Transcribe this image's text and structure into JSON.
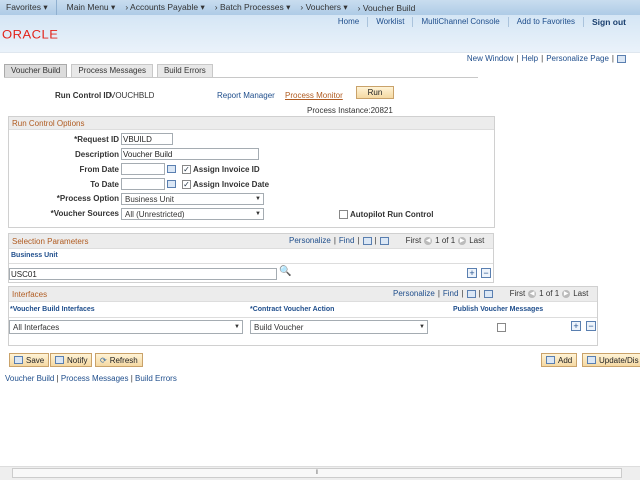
{
  "topnav": {
    "favorites": "Favorites",
    "main_menu": "Main Menu",
    "crumbs": [
      "Accounts Payable",
      "Batch Processes",
      "Vouchers",
      "Voucher Build"
    ]
  },
  "header": {
    "logo": "ORACLE",
    "links": [
      "Home",
      "Worklist",
      "MultiChannel Console",
      "Add to Favorites"
    ],
    "signout": "Sign out"
  },
  "pagelinks": {
    "new_window": "New Window",
    "help": "Help",
    "personalize": "Personalize Page"
  },
  "tabs": [
    "Voucher Build",
    "Process Messages",
    "Build Errors"
  ],
  "runbar": {
    "run_control_label": "Run Control ID",
    "run_control_value": "VOUCHBLD",
    "report_manager": "Report Manager",
    "process_monitor": "Process Monitor",
    "run": "Run",
    "process_instance": "Process Instance:20821"
  },
  "options": {
    "title": "Run Control Options",
    "request_id_label": "*Request ID",
    "request_id": "VBUILD",
    "description_label": "Description",
    "description": "Voucher Build",
    "from_date_label": "From Date",
    "from_date": "",
    "to_date_label": "To Date",
    "to_date": "",
    "assign_invoice_id": "Assign Invoice ID",
    "assign_invoice_id_checked": true,
    "assign_invoice_date": "Assign Invoice Date",
    "assign_invoice_date_checked": true,
    "process_option_label": "*Process Option",
    "process_option": "Business Unit",
    "voucher_sources_label": "*Voucher Sources",
    "voucher_sources": "All (Unrestricted)",
    "autopilot": "Autopilot Run Control",
    "autopilot_checked": false
  },
  "selection": {
    "title": "Selection Parameters",
    "personalize": "Personalize",
    "find": "Find",
    "first": "First",
    "count": "1 of 1",
    "last": "Last",
    "column": "Business Unit",
    "value": "USC01"
  },
  "interfaces": {
    "title": "Interfaces",
    "personalize": "Personalize",
    "find": "Find",
    "first": "First",
    "count": "1 of 1",
    "last": "Last",
    "columns": [
      "*Voucher Build Interfaces",
      "*Contract Voucher Action",
      "Publish Voucher Messages"
    ],
    "interface": "All Interfaces",
    "action": "Build Voucher",
    "publish_checked": false
  },
  "buttons": {
    "save": "Save",
    "notify": "Notify",
    "refresh": "Refresh",
    "add": "Add",
    "update": "Update/Dis"
  },
  "footer_links": [
    "Voucher Build",
    "Process Messages",
    "Build Errors"
  ]
}
